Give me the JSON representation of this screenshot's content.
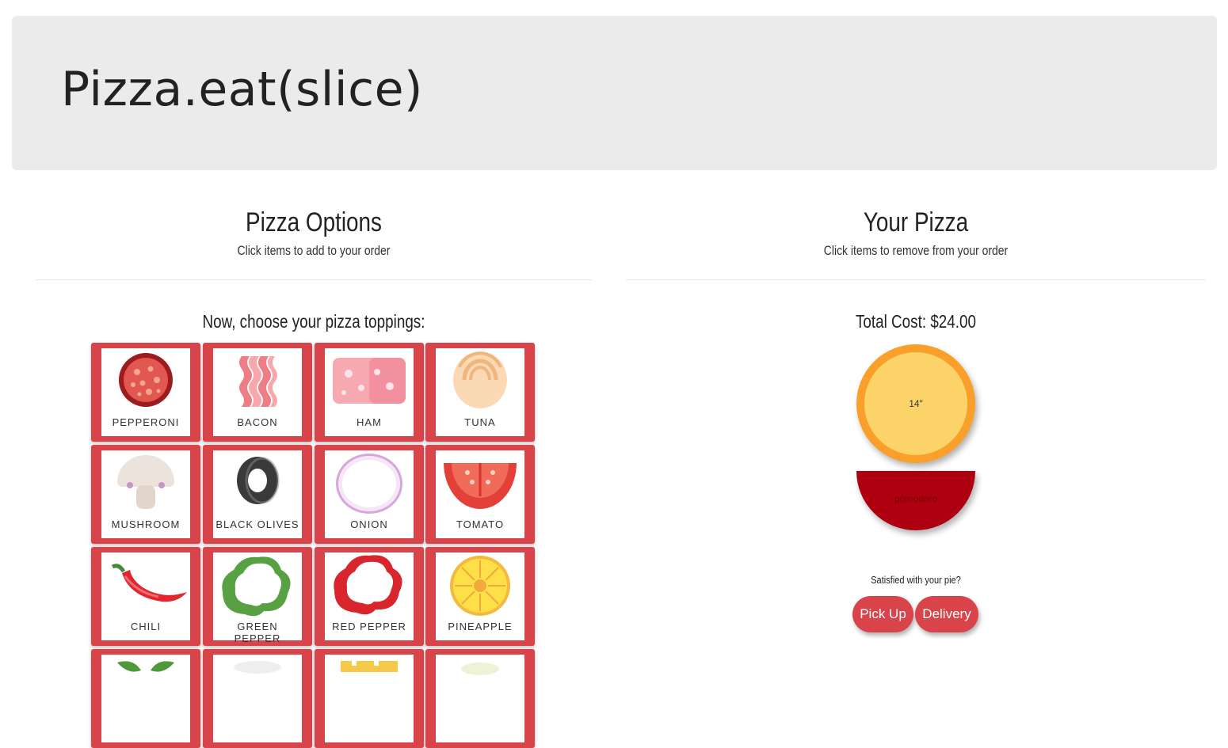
{
  "header": {
    "title": "Pizza.eat(slice)"
  },
  "options_panel": {
    "title": "Pizza Options",
    "subtitle": "Click items to add to your order",
    "prompt": "Now, choose your pizza toppings:"
  },
  "order_panel": {
    "title": "Your Pizza",
    "subtitle": "Click items to remove from your order",
    "total": "Total Cost: $24.00",
    "crust_size": "14\"",
    "sauce_label": "pomodoro",
    "satisfied": "Satisfied with your pie?",
    "pickup_label": "Pick Up",
    "delivery_label": "Delivery"
  },
  "toppings": [
    {
      "label": "Pepperoni",
      "icon": "pepperoni-icon"
    },
    {
      "label": "Bacon",
      "icon": "bacon-icon"
    },
    {
      "label": "Ham",
      "icon": "ham-icon"
    },
    {
      "label": "Tuna",
      "icon": "tuna-icon"
    },
    {
      "label": "Mushroom",
      "icon": "mushroom-icon"
    },
    {
      "label": "Black Olives",
      "icon": "black-olives-icon"
    },
    {
      "label": "Onion",
      "icon": "onion-icon"
    },
    {
      "label": "Tomato",
      "icon": "tomato-icon"
    },
    {
      "label": "Chili",
      "icon": "chili-icon"
    },
    {
      "label": "Green Pepper",
      "icon": "green-pepper-icon"
    },
    {
      "label": "Red Pepper",
      "icon": "red-pepper-icon"
    },
    {
      "label": "Pineapple",
      "icon": "pineapple-icon"
    }
  ],
  "colors": {
    "accent": "#d9434a",
    "crust": "#f99f2a",
    "dough": "#fbd368",
    "sauce": "#ae0010",
    "jumbotron": "#ebebeb"
  }
}
